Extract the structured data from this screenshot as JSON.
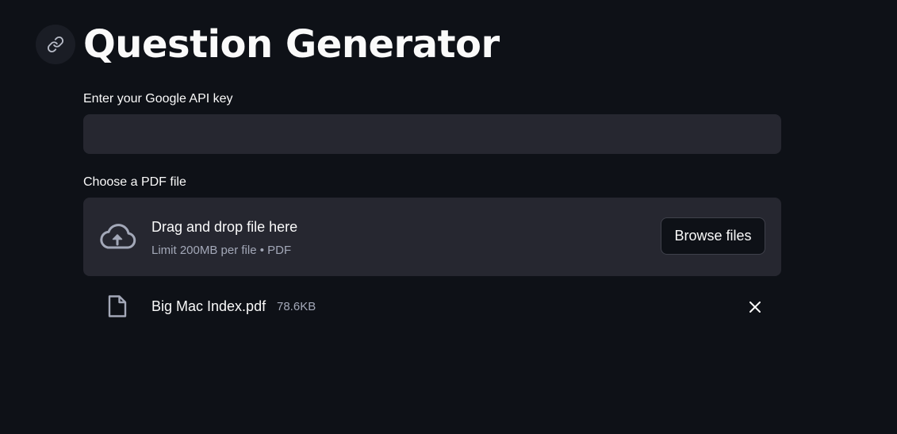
{
  "header": {
    "title": "Question Generator",
    "anchor_icon": "link-icon"
  },
  "api_key": {
    "label": "Enter your Google API key",
    "value": "",
    "placeholder": ""
  },
  "uploader": {
    "label": "Choose a PDF file",
    "dropzone_icon": "cloud-upload-icon",
    "dropzone_title": "Drag and drop file here",
    "dropzone_subtitle": "Limit 200MB per file • PDF",
    "browse_label": "Browse files"
  },
  "uploaded_file": {
    "icon": "file-icon",
    "name": "Big Mac Index.pdf",
    "size": "78.6KB",
    "remove_icon": "close-icon"
  },
  "colors": {
    "background": "#0e1117",
    "surface": "#262730",
    "text": "#fafafa",
    "muted_text": "#a3a8b8"
  }
}
